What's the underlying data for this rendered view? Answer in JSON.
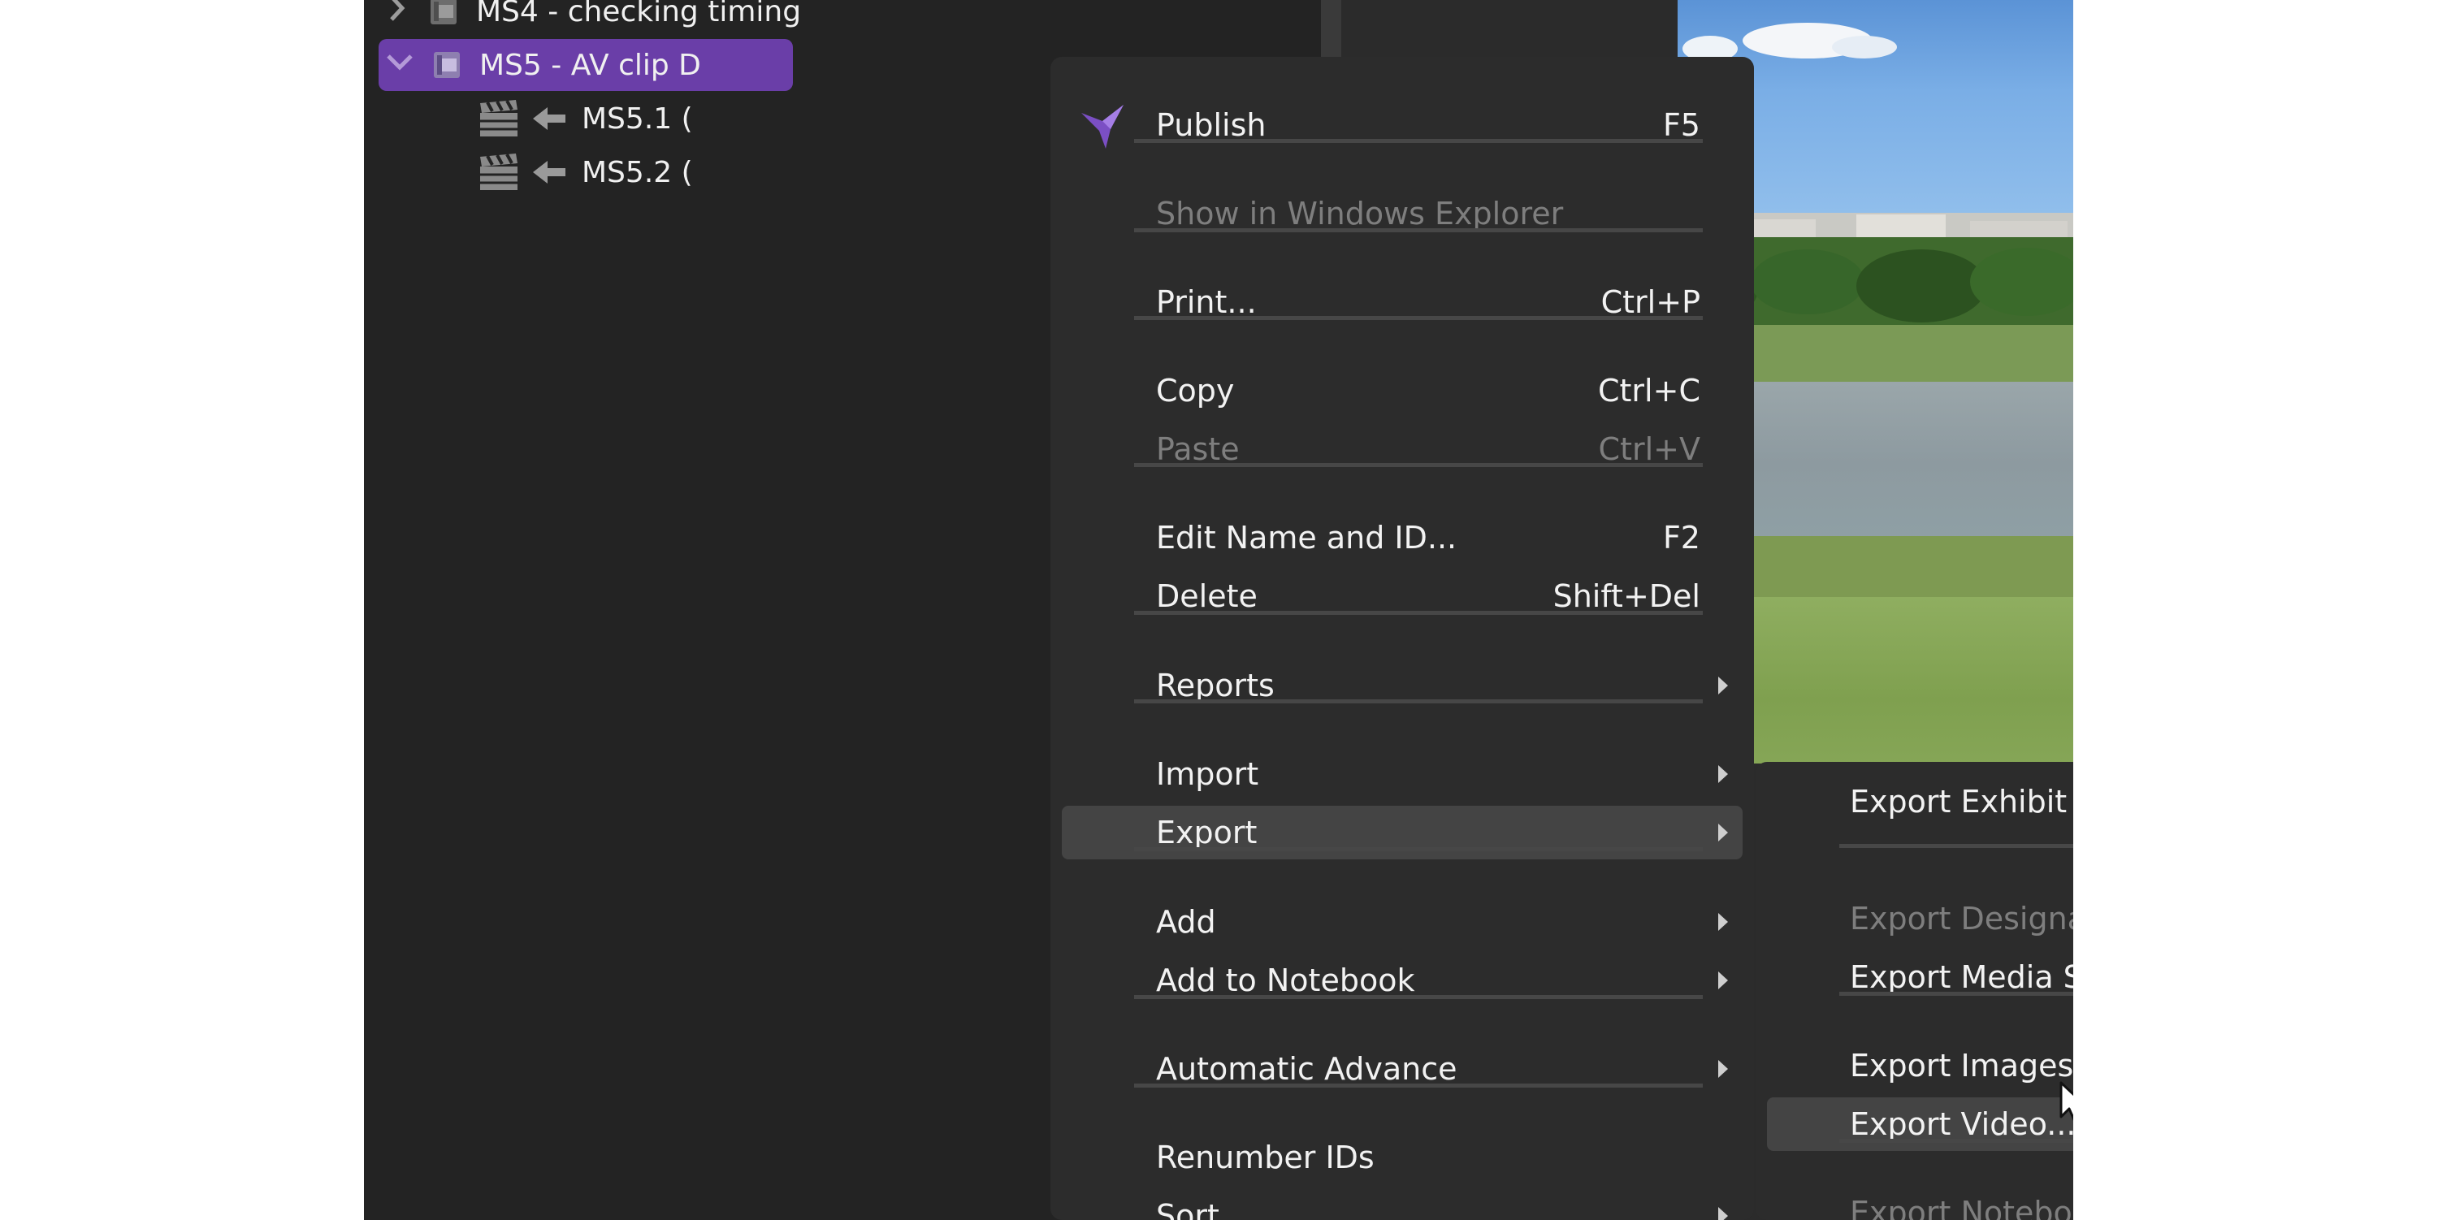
{
  "tree": {
    "items": [
      {
        "label": "MS4 - checking timing",
        "expander": "chevron-right-icon",
        "icon": "clip-group-icon"
      },
      {
        "label": "MS5 - AV clip D",
        "expander": "chevron-down-icon",
        "icon": "clip-group-icon",
        "selected": true
      },
      {
        "label": "MS5.1 (",
        "icon": "clapperboard-icon",
        "link": "arrow-left-icon"
      },
      {
        "label": "MS5.2 (",
        "icon": "clapperboard-icon",
        "link": "arrow-left-icon"
      }
    ]
  },
  "context_menu": {
    "items": [
      {
        "label": "Publish",
        "shortcut": "F5",
        "icon": "publish-bird-icon"
      },
      {
        "label": "Show in Windows Explorer",
        "disabled": true
      },
      {
        "label": "Print...",
        "shortcut": "Ctrl+P"
      },
      {
        "label": "Copy",
        "shortcut": "Ctrl+C"
      },
      {
        "label": "Paste",
        "shortcut": "Ctrl+V",
        "disabled": true
      },
      {
        "label": "Edit Name and ID...",
        "shortcut": "F2"
      },
      {
        "label": "Delete",
        "shortcut": "Shift+Del"
      },
      {
        "label": "Reports",
        "submenu": true
      },
      {
        "label": "Import",
        "submenu": true
      },
      {
        "label": "Export",
        "submenu": true,
        "highlighted": true
      },
      {
        "label": "Add",
        "submenu": true
      },
      {
        "label": "Add to Notebook",
        "submenu": true
      },
      {
        "label": "Automatic Advance",
        "submenu": true
      },
      {
        "label": "Renumber IDs"
      },
      {
        "label": "Sort",
        "submenu": true
      }
    ]
  },
  "export_submenu": {
    "items": [
      {
        "label": "Export Exhibit List..."
      },
      {
        "label": "Export Designations to Text/XML...",
        "disabled": true
      },
      {
        "label": "Export Media Scripts to Text/XML..."
      },
      {
        "label": "Export Images..."
      },
      {
        "label": "Export Video...",
        "highlighted": true
      },
      {
        "label": "Export Notebooks...",
        "disabled": true
      }
    ]
  },
  "colors": {
    "selection": "#6a3ea8",
    "menu_background": "#2c2c2c",
    "menu_hover": "#444444",
    "disabled_text": "#7e7e7e",
    "app_background": "#232323"
  }
}
